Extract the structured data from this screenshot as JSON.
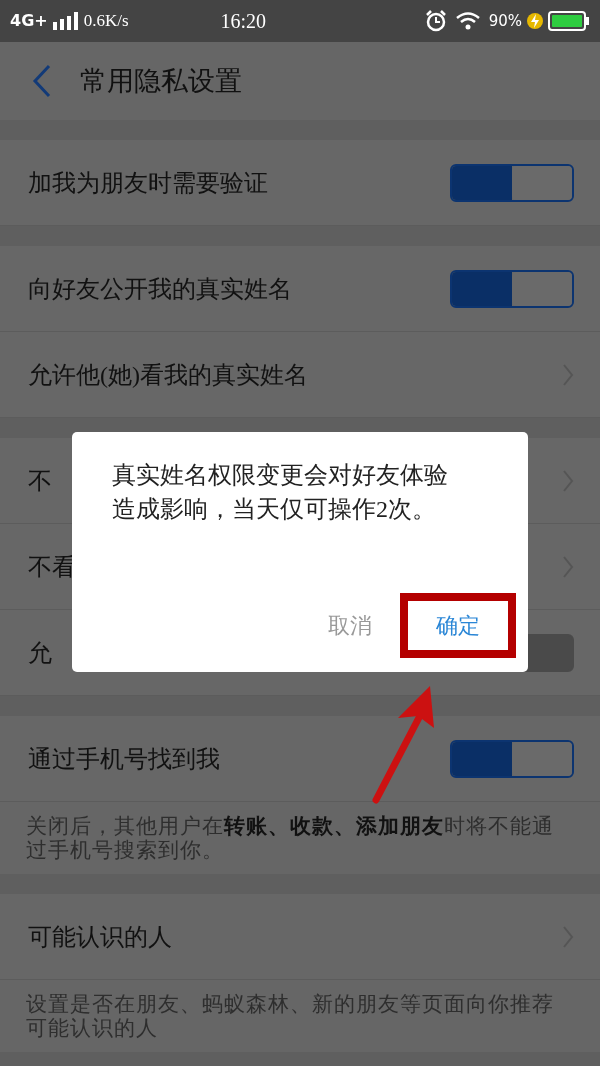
{
  "status_bar": {
    "network": "4G+",
    "speed": "0.6K/s",
    "time": "16:20",
    "battery": "90%"
  },
  "header": {
    "title": "常用隐私设置"
  },
  "sections": [
    {
      "rows": [
        {
          "kind": "toggle",
          "label": "加我为朋友时需要验证",
          "on": true
        }
      ]
    },
    {
      "rows": [
        {
          "kind": "toggle",
          "label": "向好友公开我的真实姓名",
          "on": true
        },
        {
          "kind": "link",
          "label": "允许他(她)看我的真实姓名"
        }
      ]
    },
    {
      "rows": [
        {
          "kind": "link",
          "label": "不"
        },
        {
          "kind": "link",
          "label": "不看"
        },
        {
          "kind": "toggle",
          "label": "允",
          "on": false
        }
      ]
    },
    {
      "rows": [
        {
          "kind": "toggle",
          "label": "通过手机号找到我",
          "on": true
        }
      ],
      "note": "关闭后，其他用户在**转账、收款、添加朋友**时将不能通过手机号搜索到你。"
    },
    {
      "rows": [
        {
          "kind": "link",
          "label": "可能认识的人"
        }
      ],
      "note": "设置是否在朋友、蚂蚁森林、新的朋友等页面向你推荐可能认识的人"
    }
  ],
  "dialog": {
    "message": "真实姓名权限变更会对好友体验造成影响，当天仅可操作2次。",
    "buttons": [
      {
        "label": "取消",
        "kind": "cancel"
      },
      {
        "label": "确定",
        "kind": "confirm",
        "highlighted": true
      }
    ]
  }
}
